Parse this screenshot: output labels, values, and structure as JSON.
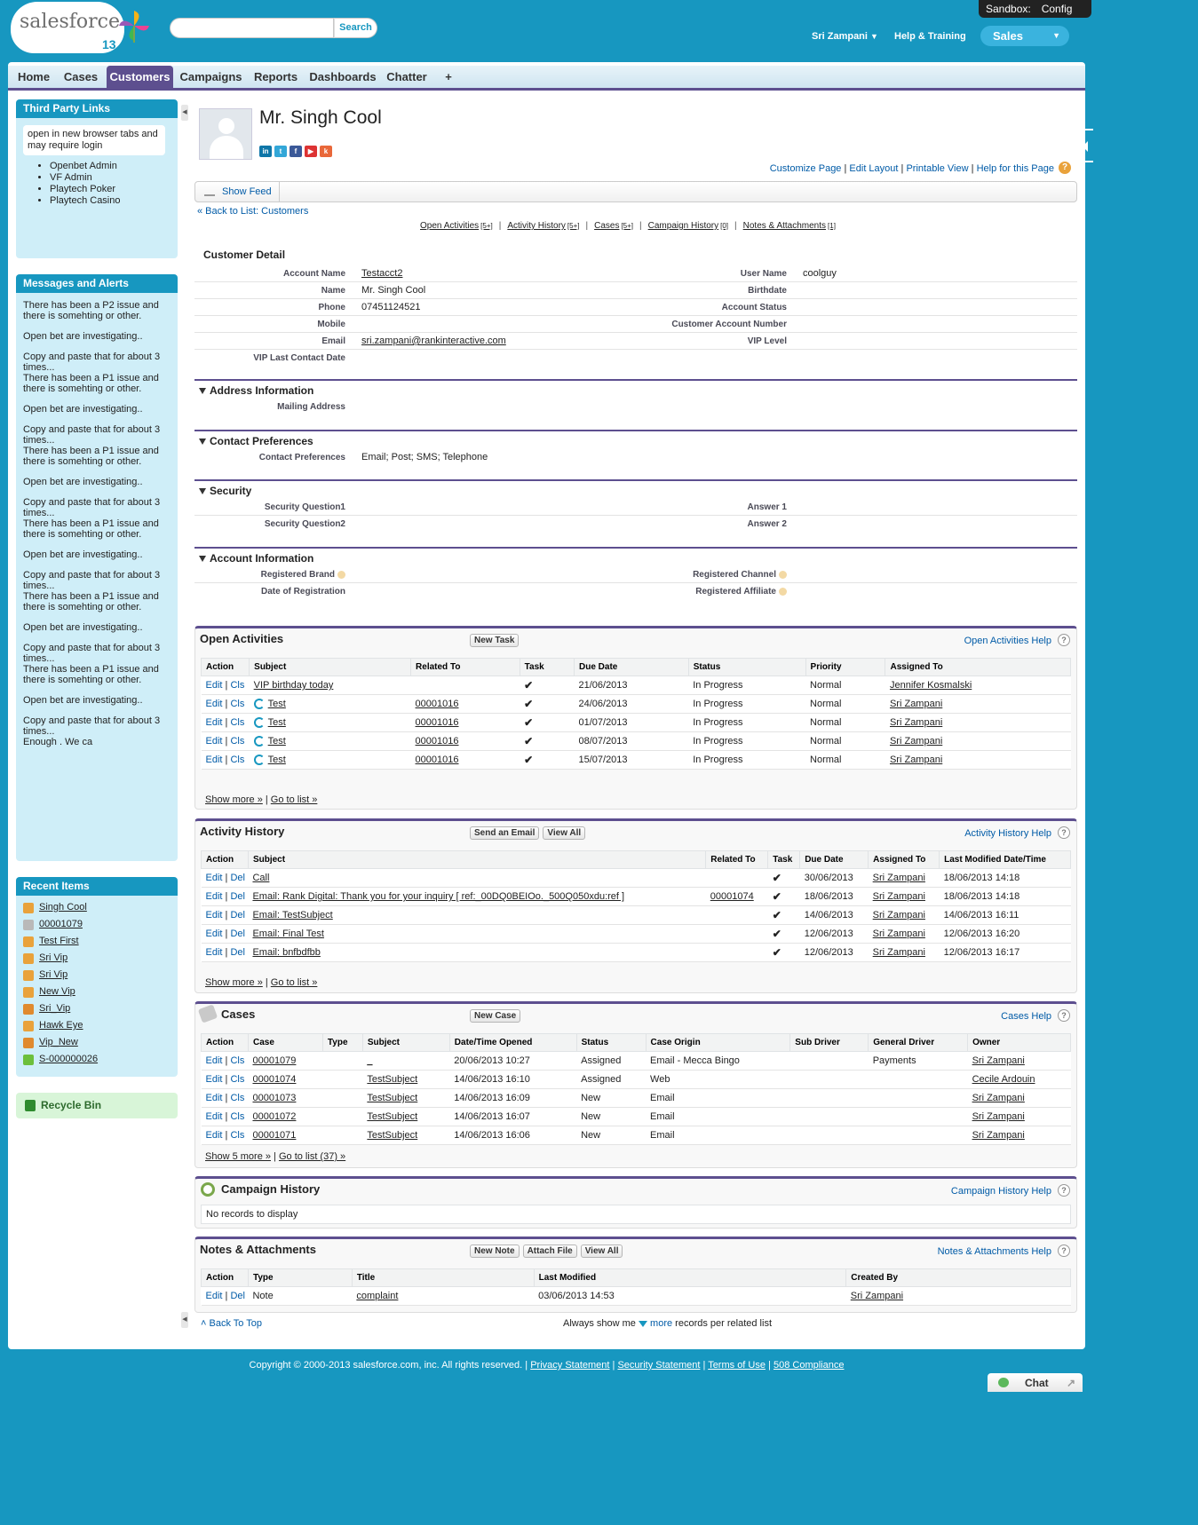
{
  "header": {
    "logo_text": "salesforce",
    "logo_number": "13",
    "search_placeholder": "",
    "search_button": "Search",
    "sandbox_label": "Sandbox:",
    "sandbox_value": "Config",
    "user_name": "Sri Zampani",
    "help_training": "Help & Training",
    "app_name": "Sales"
  },
  "tabs": [
    "Home",
    "Cases",
    "Customers",
    "Campaigns",
    "Reports",
    "Dashboards",
    "Chatter",
    "+"
  ],
  "active_tab": "Customers",
  "sidebar": {
    "third_party": {
      "title": "Third Party Links",
      "note": "open in new browser tabs and may require login",
      "links": [
        "Openbet Admin",
        "VF Admin",
        "Playtech Poker",
        "Playtech Casino"
      ]
    },
    "messages": {
      "title": "Messages and Alerts",
      "items": [
        "There has been a P2 issue and there is somehting or other.",
        "Open bet are investigating..",
        "Copy and paste that for about 3 times...\nThere has been a P1 issue and there is somehting or other.",
        "Open bet are investigating..",
        "Copy and paste that for about 3 times...\nThere has been a P1 issue and there is somehting or other.",
        "Open bet are investigating..",
        "Copy and paste that for about 3 times...\nThere has been a P1 issue and there is somehting or other.",
        "Open bet are investigating..",
        "Copy and paste that for about 3 times...\nThere has been a P1 issue and there is somehting or other.",
        "Open bet are investigating..",
        "Copy and paste that for about 3 times...\nThere has been a P1 issue and there is somehting or other.",
        "Open bet are investigating..",
        "Copy and paste that for about 3 times...\nEnough . We ca"
      ]
    },
    "recent": {
      "title": "Recent Items",
      "items": [
        {
          "label": "Singh Cool",
          "icon": "person-icon",
          "color": "#e9a23b"
        },
        {
          "label": "00001079",
          "icon": "case-icon",
          "color": "#b9b9b9"
        },
        {
          "label": "Test First",
          "icon": "person-icon",
          "color": "#e9a23b"
        },
        {
          "label": "Sri Vip",
          "icon": "person-icon",
          "color": "#e9a23b"
        },
        {
          "label": "Sri Vip",
          "icon": "person-icon",
          "color": "#e9a23b"
        },
        {
          "label": "New Vip",
          "icon": "person-icon",
          "color": "#e9a23b"
        },
        {
          "label": "Sri_Vip",
          "icon": "account-icon",
          "color": "#e08a2e"
        },
        {
          "label": "Hawk Eye",
          "icon": "person-icon",
          "color": "#e9a23b"
        },
        {
          "label": "Vip_New",
          "icon": "account-icon",
          "color": "#e08a2e"
        },
        {
          "label": "S-000000026",
          "icon": "leaf-icon",
          "color": "#6cbf3b"
        }
      ]
    },
    "recycle_bin": "Recycle Bin"
  },
  "record": {
    "name": "Mr. Singh Cool",
    "top_links": [
      "Customize Page",
      "Edit Layout",
      "Printable View",
      "Help for this Page"
    ],
    "show_feed": "Show Feed",
    "back_to_list": "« Back to List: Customers",
    "related_links": [
      {
        "label": "Open Activities",
        "count": "[5+]"
      },
      {
        "label": "Activity History",
        "count": "[5+]"
      },
      {
        "label": "Cases",
        "count": "[5+]"
      },
      {
        "label": "Campaign History",
        "count": "[0]"
      },
      {
        "label": "Notes & Attachments",
        "count": "[1]"
      }
    ]
  },
  "detail": {
    "title": "Customer Detail",
    "rows": [
      {
        "l1": "Account Name",
        "v1": "Testacct2",
        "l2": "User Name",
        "v2": "coolguy"
      },
      {
        "l1": "Name",
        "v1": "Mr. Singh Cool",
        "l2": "Birthdate",
        "v2": ""
      },
      {
        "l1": "Phone",
        "v1": "07451124521",
        "l2": "Account Status",
        "v2": ""
      },
      {
        "l1": "Mobile",
        "v1": "",
        "l2": "Customer Account Number",
        "v2": ""
      },
      {
        "l1": "Email",
        "v1": "sri.zampani@rankinteractive.com",
        "l2": "VIP Level",
        "v2": ""
      },
      {
        "l1": "VIP Last Contact Date",
        "v1": "",
        "l2": "",
        "v2": ""
      }
    ],
    "address": {
      "title": "Address Information",
      "label": "Mailing Address",
      "value": ""
    },
    "contact_pref": {
      "title": "Contact Preferences",
      "label": "Contact Preferences",
      "value": "Email; Post; SMS; Telephone"
    },
    "security": {
      "title": "Security",
      "rows": [
        {
          "l1": "Security Question1",
          "l2": "Answer 1"
        },
        {
          "l1": "Security Question2",
          "l2": "Answer 2"
        }
      ]
    },
    "account_info": {
      "title": "Account Information",
      "rows": [
        {
          "l1": "Registered Brand",
          "l2": "Registered Channel"
        },
        {
          "l1": "Date of Registration",
          "l2": "Registered Affiliate"
        }
      ]
    }
  },
  "open_activities": {
    "title": "Open Activities",
    "buttons": [
      "New Task"
    ],
    "help": "Open Activities Help",
    "columns": [
      "Action",
      "Subject",
      "Related To",
      "Task",
      "Due Date",
      "Status",
      "Priority",
      "Assigned To"
    ],
    "rows": [
      {
        "action": "Edit | Cls",
        "subject": "VIP birthday today",
        "recurring": false,
        "related": "",
        "task": "✔",
        "due": "21/06/2013",
        "status": "In Progress",
        "priority": "Normal",
        "assigned": "Jennifer Kosmalski"
      },
      {
        "action": "Edit | Cls",
        "subject": "Test",
        "recurring": true,
        "related": "00001016",
        "task": "✔",
        "due": "24/06/2013",
        "status": "In Progress",
        "priority": "Normal",
        "assigned": "Sri Zampani"
      },
      {
        "action": "Edit | Cls",
        "subject": "Test",
        "recurring": true,
        "related": "00001016",
        "task": "✔",
        "due": "01/07/2013",
        "status": "In Progress",
        "priority": "Normal",
        "assigned": "Sri Zampani"
      },
      {
        "action": "Edit | Cls",
        "subject": "Test",
        "recurring": true,
        "related": "00001016",
        "task": "✔",
        "due": "08/07/2013",
        "status": "In Progress",
        "priority": "Normal",
        "assigned": "Sri Zampani"
      },
      {
        "action": "Edit | Cls",
        "subject": "Test",
        "recurring": true,
        "related": "00001016",
        "task": "✔",
        "due": "15/07/2013",
        "status": "In Progress",
        "priority": "Normal",
        "assigned": "Sri Zampani"
      }
    ],
    "show_more": "Show more »",
    "go_to_list": "Go to list »"
  },
  "activity_history": {
    "title": "Activity History",
    "buttons": [
      "Send an Email",
      "View All"
    ],
    "help": "Activity History Help",
    "columns": [
      "Action",
      "Subject",
      "Related To",
      "Task",
      "Due Date",
      "Assigned To",
      "Last Modified Date/Time"
    ],
    "rows": [
      {
        "action": "Edit | Del",
        "subject": "Call",
        "related": "",
        "task": "✔",
        "due": "30/06/2013",
        "assigned": "Sri Zampani",
        "modified": "18/06/2013 14:18"
      },
      {
        "action": "Edit | Del",
        "subject": "Email: Rank Digital: Thank you for your inquiry [ ref:_00DQ0BEIOo._500Q050xdu:ref ]",
        "related": "00001074",
        "task": "✔",
        "due": "18/06/2013",
        "assigned": "Sri Zampani",
        "modified": "18/06/2013 14:18"
      },
      {
        "action": "Edit | Del",
        "subject": "Email: TestSubject",
        "related": "",
        "task": "✔",
        "due": "14/06/2013",
        "assigned": "Sri Zampani",
        "modified": "14/06/2013 16:11"
      },
      {
        "action": "Edit | Del",
        "subject": "Email: Final Test",
        "related": "",
        "task": "✔",
        "due": "12/06/2013",
        "assigned": "Sri Zampani",
        "modified": "12/06/2013 16:20"
      },
      {
        "action": "Edit | Del",
        "subject": "Email: bnfbdfbb",
        "related": "",
        "task": "✔",
        "due": "12/06/2013",
        "assigned": "Sri Zampani",
        "modified": "12/06/2013 16:17"
      }
    ],
    "show_more": "Show more »",
    "go_to_list": "Go to list »"
  },
  "cases": {
    "title": "Cases",
    "buttons": [
      "New Case"
    ],
    "help": "Cases Help",
    "columns": [
      "Action",
      "Case",
      "Type",
      "Subject",
      "Date/Time Opened",
      "Status",
      "Case Origin",
      "Sub Driver",
      "General Driver",
      "Owner"
    ],
    "rows": [
      {
        "action": "Edit | Cls",
        "case": "00001079",
        "type": "",
        "subject": "_",
        "opened": "20/06/2013 10:27",
        "status": "Assigned",
        "origin": "Email - Mecca Bingo",
        "sub": "",
        "general": "Payments",
        "owner": "Sri Zampani"
      },
      {
        "action": "Edit | Cls",
        "case": "00001074",
        "type": "",
        "subject": "TestSubject",
        "opened": "14/06/2013 16:10",
        "status": "Assigned",
        "origin": "Web",
        "sub": "",
        "general": "",
        "owner": "Cecile Ardouin"
      },
      {
        "action": "Edit | Cls",
        "case": "00001073",
        "type": "",
        "subject": "TestSubject",
        "opened": "14/06/2013 16:09",
        "status": "New",
        "origin": "Email",
        "sub": "",
        "general": "",
        "owner": "Sri Zampani"
      },
      {
        "action": "Edit | Cls",
        "case": "00001072",
        "type": "",
        "subject": "TestSubject",
        "opened": "14/06/2013 16:07",
        "status": "New",
        "origin": "Email",
        "sub": "",
        "general": "",
        "owner": "Sri Zampani"
      },
      {
        "action": "Edit | Cls",
        "case": "00001071",
        "type": "",
        "subject": "TestSubject",
        "opened": "14/06/2013 16:06",
        "status": "New",
        "origin": "Email",
        "sub": "",
        "general": "",
        "owner": "Sri Zampani"
      }
    ],
    "show_more": "Show 5 more »",
    "go_to_list": "Go to list (37) »"
  },
  "campaign_history": {
    "title": "Campaign History",
    "help": "Campaign History Help",
    "empty": "No records to display"
  },
  "notes": {
    "title": "Notes & Attachments",
    "buttons": [
      "New Note",
      "Attach File",
      "View All"
    ],
    "help": "Notes & Attachments Help",
    "columns": [
      "Action",
      "Type",
      "Title",
      "Last Modified",
      "Created By"
    ],
    "rows": [
      {
        "action": "Edit | Del",
        "type": "Note",
        "title": "complaint",
        "modified": "03/06/2013 14:53",
        "created": "Sri Zampani"
      }
    ]
  },
  "bottom": {
    "back_to_top": "Back To Top",
    "always_pre": "Always show me",
    "always_more": "more",
    "always_post": "records per related list"
  },
  "footer": {
    "copyright": "Copyright © 2000-2013 salesforce.com, inc. All rights reserved.",
    "links": [
      "Privacy Statement",
      "Security Statement",
      "Terms of Use",
      "508 Compliance"
    ],
    "chat": "Chat"
  },
  "colors": {
    "brand": "#1797c0",
    "tab_active": "#5d4f8f",
    "link": "#015ba7"
  }
}
